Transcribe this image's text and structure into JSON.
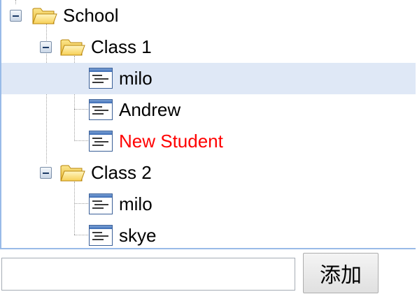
{
  "tree": {
    "root": {
      "label": "School",
      "icon": "folder-open-icon",
      "expanded": true,
      "children": [
        {
          "label": "Class 1",
          "icon": "folder-open-icon",
          "expanded": true,
          "children": [
            {
              "label": "milo",
              "icon": "leaf-node-icon",
              "selected": true
            },
            {
              "label": "Andrew",
              "icon": "leaf-node-icon"
            },
            {
              "label": "New Student",
              "icon": "leaf-node-icon",
              "color": "#ff0000"
            }
          ]
        },
        {
          "label": "Class 2",
          "icon": "folder-open-icon",
          "expanded": true,
          "children": [
            {
              "label": "milo",
              "icon": "leaf-node-icon"
            },
            {
              "label": "skye",
              "icon": "leaf-node-icon"
            }
          ]
        }
      ]
    }
  },
  "form": {
    "input_value": "",
    "input_placeholder": "",
    "add_label": "添加"
  },
  "colors": {
    "selection": "#dfe8f6",
    "panel_border": "#99bbe8",
    "highlight_text": "#ff0000"
  }
}
